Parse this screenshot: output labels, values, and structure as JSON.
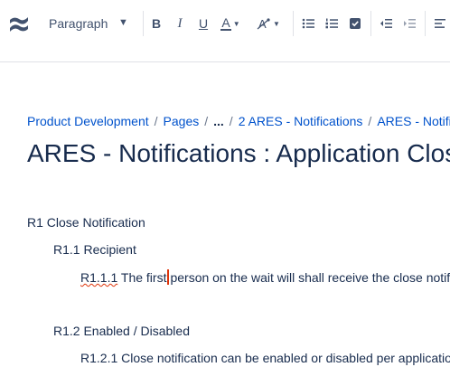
{
  "toolbar": {
    "logo_icon": "confluence-logo",
    "paragraph_style": "Paragraph",
    "bold_label": "B",
    "italic_label": "I",
    "underline_label": "U",
    "text_color_label": "A",
    "more_formatting_label": "A"
  },
  "breadcrumb": {
    "items": [
      "Product Development",
      "Pages",
      "...",
      "2 ARES - Notifications",
      "ARES - Notifi"
    ],
    "separator": "/"
  },
  "page_title": "ARES - Notifications : Application Clos",
  "content": {
    "heading_r1": "R1 Close Notification",
    "heading_r1_1": "R1.1 Recipient",
    "r1_1_1_number": "R1.1.1",
    "r1_1_1_text_before_cursor": " The first",
    "r1_1_1_text_after_cursor": "person on the wait will shall receive the close notif",
    "heading_r1_2": "R1.2 Enabled / Disabled",
    "r1_2_1_text": "R1.2.1 Close notification can be enabled or disabled per applicatio"
  },
  "colors": {
    "link": "#0052cc",
    "text": "#172b4d",
    "icon": "#42526e",
    "cursor": "#de350b",
    "divider": "#dfe1e6"
  }
}
